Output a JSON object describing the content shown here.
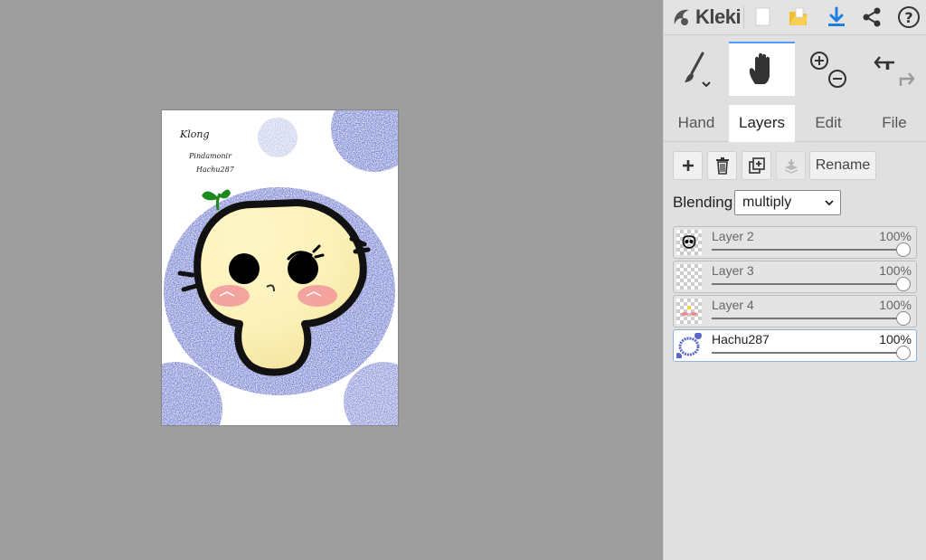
{
  "app": {
    "name": "Kleki"
  },
  "canvas_text": {
    "line1": "Klong",
    "line2": "Pindamonir",
    "line3": "Hachu287"
  },
  "tabs": [
    {
      "label": "Hand",
      "active": false
    },
    {
      "label": "Layers",
      "active": true
    },
    {
      "label": "Edit",
      "active": false
    },
    {
      "label": "File",
      "active": false
    }
  ],
  "layer_toolbar": {
    "rename_label": "Rename"
  },
  "blending": {
    "label": "Blending",
    "value": "multiply"
  },
  "layers": [
    {
      "name": "Layer 2",
      "opacity": "100%",
      "opacity_fraction": 1.0,
      "active": false
    },
    {
      "name": "Layer 3",
      "opacity": "100%",
      "opacity_fraction": 1.0,
      "active": false
    },
    {
      "name": "Layer 4",
      "opacity": "100%",
      "opacity_fraction": 1.0,
      "active": false
    },
    {
      "name": "Hachu287",
      "opacity": "100%",
      "opacity_fraction": 1.0,
      "active": true
    }
  ],
  "colors": {
    "accent": "#4f9bff",
    "download_icon": "#1f7fe0",
    "folder_icon": "#f4bf2a",
    "panel_bg": "#e0e0e0",
    "workspace_bg": "#9e9e9e"
  },
  "icons": {
    "logo": "kleki-logo-icon",
    "new": "new-file-icon",
    "open": "open-folder-icon",
    "download": "download-icon",
    "share": "share-icon",
    "help": "help-icon",
    "brush": "brush-icon",
    "hand": "hand-icon",
    "zoom_in": "zoom-in-icon",
    "zoom_out": "zoom-out-icon",
    "undo": "undo-icon",
    "redo": "redo-icon",
    "add_layer": "plus-icon",
    "delete_layer": "trash-icon",
    "duplicate_layer": "duplicate-icon",
    "merge_layer": "merge-down-icon"
  }
}
